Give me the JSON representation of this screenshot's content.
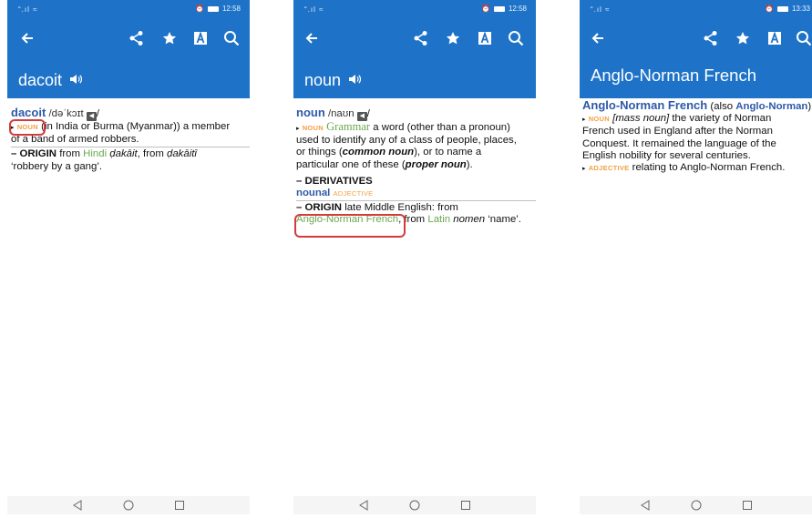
{
  "panels": [
    {
      "status_left": "“.ıl ≈",
      "status_time": "12:58",
      "headword": "dacoit",
      "entry": {
        "hw": "dacoit",
        "pron": "/dəˈkɔɪt",
        "pron_end": "/",
        "pos": "NOUN",
        "def_lines": [
          "(in India or Burma (Myanmar)) a member",
          "of a band of armed robbers."
        ],
        "origin_label": "– ORIGIN",
        "origin_from1": "from",
        "origin_lang1": "Hindi",
        "origin_word1": "ḍakāit",
        "origin_comma": ", from",
        "origin_word2": "ḍakāitī",
        "origin_gloss": "‘robbery by a gang’."
      }
    },
    {
      "status_left": "“.ıl ≈",
      "status_time": "12:58",
      "headword": "noun",
      "entry": {
        "hw": "noun",
        "pron": "/naʊn",
        "pron_end": "/",
        "pos": "NOUN",
        "field": "Grammar",
        "def_lines_a": "a word (other than a pronoun)",
        "def_line2": "used to identify any of a class of people, places,",
        "def_line3a": "or things (",
        "common": "common noun",
        "def_line3b": "), or to name a",
        "def_line4a": "particular one of these (",
        "proper": "proper noun",
        "def_line4b": ").",
        "deriv_label": "– DERIVATIVES",
        "deriv_word": "nounal",
        "deriv_pos": "ADJECTIVE",
        "origin_label": "– ORIGIN",
        "origin_text": "late Middle English: from",
        "origin_link": "Anglo-Norman French",
        "origin_mid": ", from",
        "origin_lang": "Latin",
        "origin_word": "nomen",
        "origin_gloss": "‘name’."
      }
    },
    {
      "status_left": "“.ıl ≈",
      "status_time": "13:33",
      "headword": "Anglo-Norman French",
      "entry": {
        "hw": "Anglo-Norman French",
        "also_a": "(also",
        "also_word": "Anglo-Norman",
        "also_b": ")",
        "pos": "NOUN",
        "mass": "[mass noun]",
        "def_l1": "the variety of Norman",
        "def_l2": "French used in England after the Norman",
        "def_l3": "Conquest. It remained the language of the",
        "def_l4": "English nobility for several centuries.",
        "adj_pos": "ADJECTIVE",
        "adj_def": "relating to Anglo-Norman French."
      }
    }
  ],
  "colors": {
    "appbar": "#1e73c8",
    "headword": "#2d5aa8",
    "pos": "#f0a040",
    "link": "#6aa84f",
    "highlight": "#d63a3a"
  },
  "icons": [
    "back-arrow-icon",
    "share-icon",
    "star-icon",
    "font-size-icon",
    "search-icon",
    "speaker-icon",
    "nav-back-icon",
    "nav-home-icon",
    "nav-recents-icon"
  ]
}
